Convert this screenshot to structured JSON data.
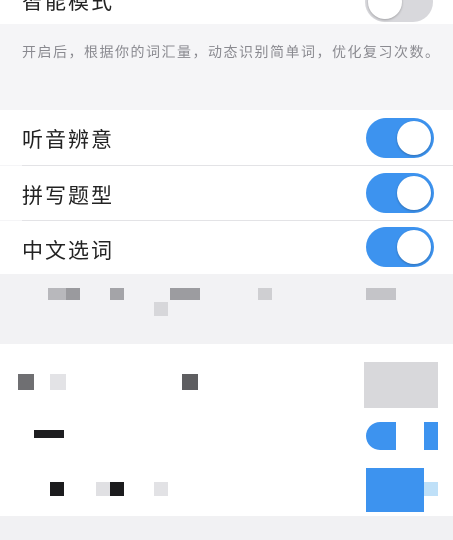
{
  "smart_mode": {
    "label": "智能模式",
    "enabled": false,
    "description": "开启后，根据你的词汇量，动态识别简单词，优化复习次数。"
  },
  "question_types": [
    {
      "label": "听音辨意",
      "enabled": true
    },
    {
      "label": "拼写题型",
      "enabled": true
    },
    {
      "label": "中文选词",
      "enabled": true
    }
  ],
  "colors": {
    "toggle_on": "#3d93ef",
    "toggle_off": "#d8d8dc",
    "background": "#f5f5f7"
  }
}
